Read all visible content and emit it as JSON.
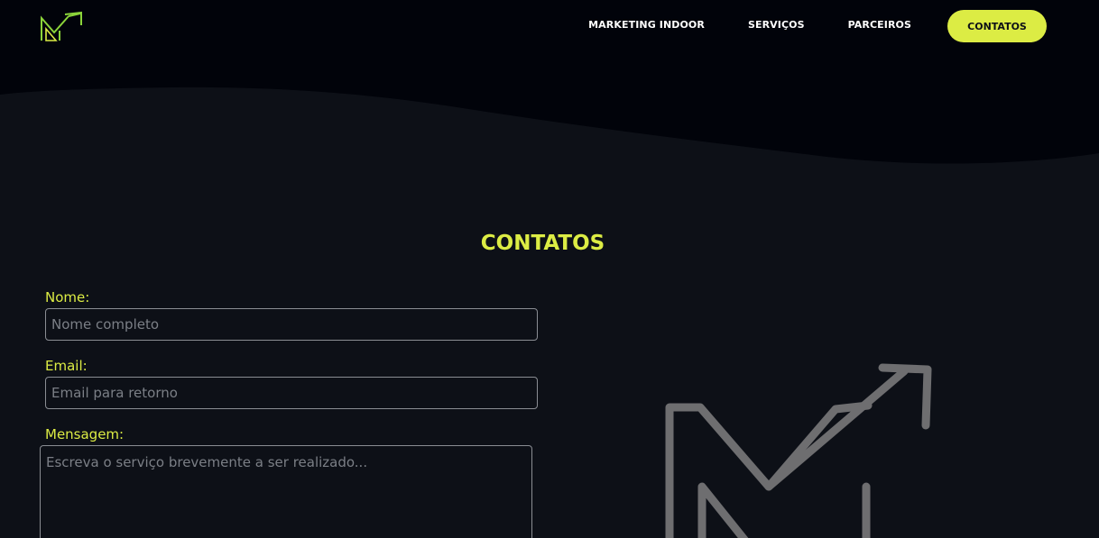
{
  "header": {
    "logo_name": "brand-logo",
    "accent_color": "#dcec44",
    "nav": {
      "items": [
        "MARKETING INDOOR",
        "SERVIÇOS",
        "PARCEIROS"
      ],
      "cta_label": "CONTATOS"
    }
  },
  "contact": {
    "title": "CONTATOS",
    "form": {
      "name_label": "Nome:",
      "name_placeholder": "Nome completo",
      "email_label": "Email:",
      "email_placeholder": "Email para retorno",
      "message_label": "Mensagem:",
      "message_placeholder": "Escreva o serviço brevemente a ser realizado..."
    }
  },
  "colors": {
    "background": "#0d1017",
    "header_bg": "#01030a",
    "accent": "#dcec44",
    "logo_gray": "#6e6e70"
  }
}
